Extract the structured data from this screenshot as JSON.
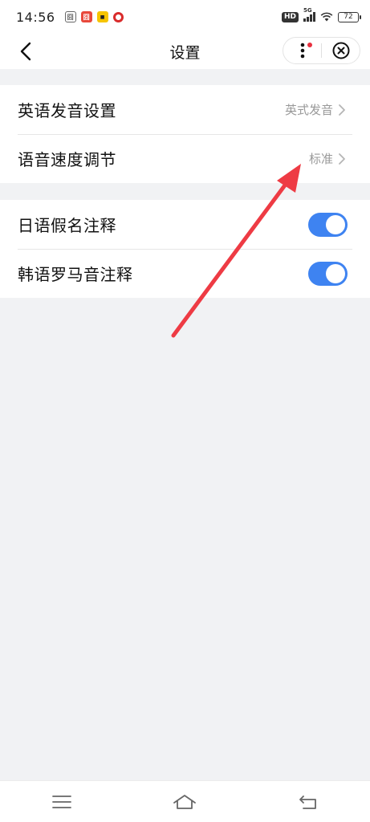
{
  "status_bar": {
    "time": "14:56",
    "network_badge": "HD",
    "network_type": "5G",
    "battery_level": "72"
  },
  "nav": {
    "title": "设置"
  },
  "settings": {
    "group1": [
      {
        "label": "英语发音设置",
        "value": "英式发音"
      },
      {
        "label": "语音速度调节",
        "value": "标准"
      }
    ],
    "group2": [
      {
        "label": "日语假名注释",
        "enabled": true
      },
      {
        "label": "韩语罗马音注释",
        "enabled": true
      }
    ]
  },
  "colors": {
    "toggle_on": "#3e83f1",
    "annotation_arrow": "#ee3b44",
    "background": "#f1f2f4"
  }
}
